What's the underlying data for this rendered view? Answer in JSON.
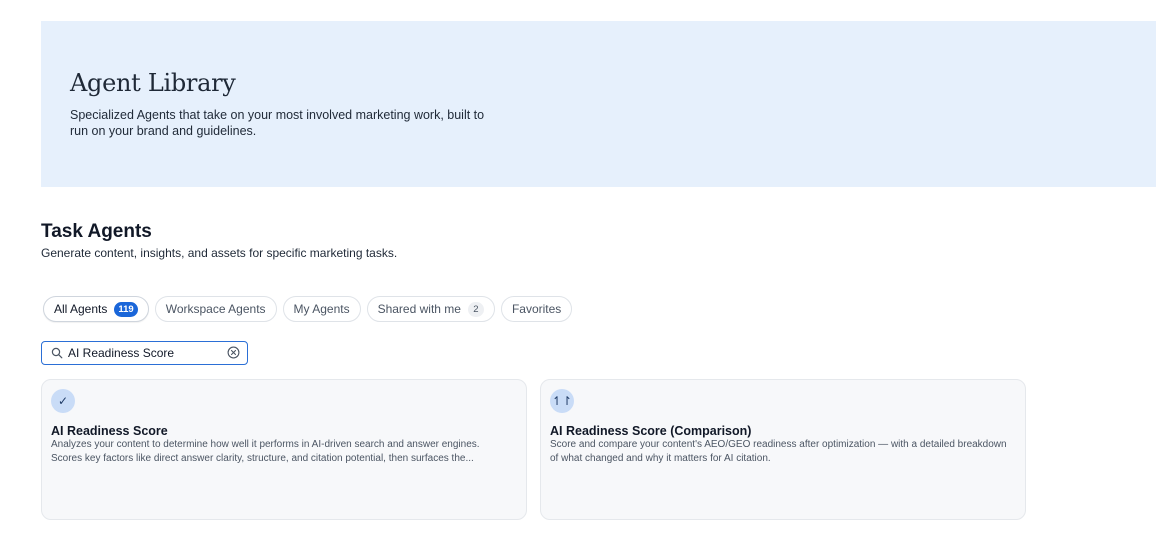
{
  "hero": {
    "title": "Agent Library",
    "subtitle": "Specialized Agents that take on your most involved marketing work, built to run on your brand and guidelines."
  },
  "section": {
    "title": "Task Agents",
    "subtitle": "Generate content, insights, and assets for specific marketing tasks."
  },
  "filters": {
    "all": {
      "label": "All Agents",
      "count": "119"
    },
    "workspace": {
      "label": "Workspace Agents"
    },
    "mine": {
      "label": "My Agents"
    },
    "shared": {
      "label": "Shared with me",
      "count": "2"
    },
    "favorites": {
      "label": "Favorites"
    }
  },
  "search": {
    "value": "AI Readiness Score",
    "icon": "search-icon",
    "clear_icon": "clear-icon"
  },
  "cards": [
    {
      "icon_glyph": "✓",
      "icon": "check-icon",
      "title": "AI Readiness Score",
      "description": "Analyzes your content to determine how well it performs in AI-driven search and answer engines. Scores key factors like direct answer clarity, structure, and citation potential, then surfaces the..."
    },
    {
      "icon_glyph": "↿↾",
      "icon": "compare-arrows-icon",
      "title": "AI Readiness Score (Comparison)",
      "description": "Score and compare your content's AEO/GEO readiness after optimization — with a detailed breakdown of what changed and why it matters for AI citation."
    }
  ],
  "colors": {
    "hero_bg": "#e6f0fc",
    "accent": "#1a66d9",
    "card_bg": "#f7f8fa",
    "card_icon_bg": "#c9dcf7"
  }
}
